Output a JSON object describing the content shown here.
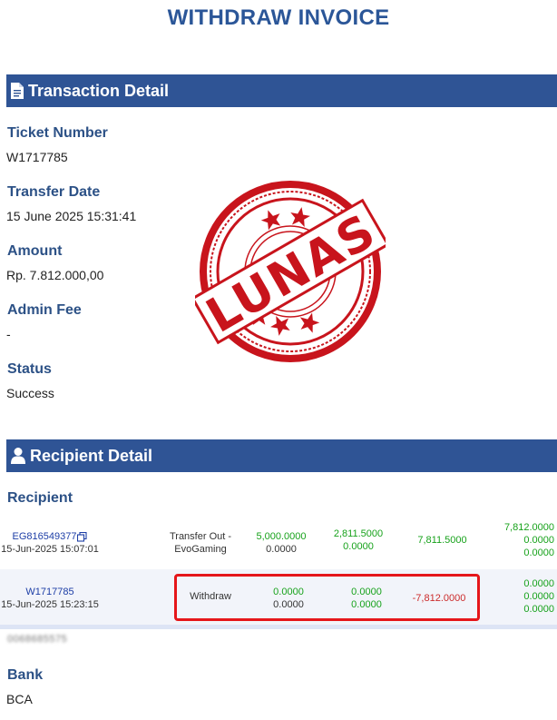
{
  "header": {
    "title": "WITHDRAW INVOICE"
  },
  "transaction_detail": {
    "heading": "Transaction Detail",
    "fields": [
      {
        "label": "Ticket Number",
        "value": "W1717785"
      },
      {
        "label": "Transfer Date",
        "value": "15 June 2025 15:31:41"
      },
      {
        "label": "Amount",
        "value": "Rp. 7.812.000,00"
      },
      {
        "label": "Admin Fee",
        "value": "-"
      },
      {
        "label": "Status",
        "value": "Success"
      }
    ]
  },
  "stamp": {
    "text": "LUNAS",
    "color": "#c8141c"
  },
  "recipient_detail": {
    "heading": "Recipient Detail",
    "recipient_label": "Recipient",
    "transactions": [
      {
        "id": "EG816549377",
        "datetime": "15-Jun-2025 15:07:01",
        "type_line1": "Transfer Out -",
        "type_line2": "EvoGaming",
        "col1_top": "5,000.0000",
        "col1_bottom": "0.0000",
        "col2_top": "2,811.5000",
        "col2_bottom": "0.0000",
        "amount": "7,811.5000",
        "balance_1": "7,812.0000",
        "balance_2": "0.0000",
        "balance_3": "0.0000"
      },
      {
        "id": "W1717785",
        "datetime": "15-Jun-2025 15:23:15",
        "type_line1": "Withdraw",
        "col1_top": "0.0000",
        "col1_bottom": "0.0000",
        "col2_top": "0.0000",
        "col2_bottom": "0.0000",
        "amount": "-7,812.0000",
        "balance_1": "0.0000",
        "balance_2": "0.0000",
        "balance_3": "0.0000"
      }
    ],
    "redacted_text": "0068685575",
    "bank_label": "Bank",
    "bank_value": "BCA"
  },
  "colors": {
    "accent": "#2f5495",
    "green": "#17a21b",
    "red": "#cc2b2b",
    "highlight": "#e5161a"
  }
}
